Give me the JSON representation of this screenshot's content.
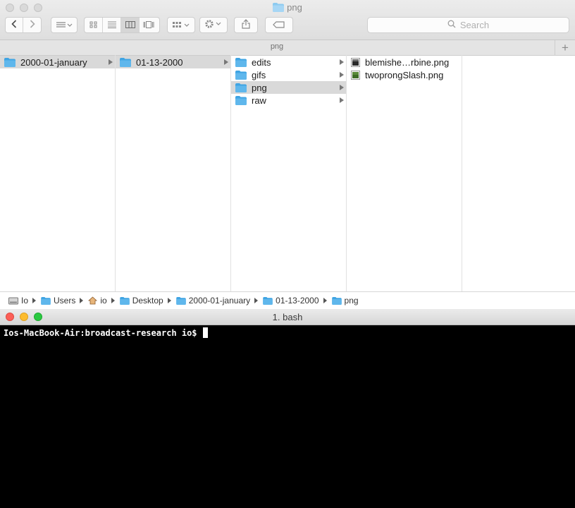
{
  "finder": {
    "window_title": "png",
    "search_placeholder": "Search",
    "tab_title": "png",
    "columns": [
      {
        "items": [
          {
            "label": "2000-01-january",
            "selected": true,
            "has_children": true
          }
        ]
      },
      {
        "items": [
          {
            "label": "01-13-2000",
            "selected": true,
            "has_children": true
          }
        ]
      },
      {
        "items": [
          {
            "label": "edits",
            "selected": false,
            "has_children": true
          },
          {
            "label": "gifs",
            "selected": false,
            "has_children": true
          },
          {
            "label": "png",
            "selected": true,
            "has_children": true
          },
          {
            "label": "raw",
            "selected": false,
            "has_children": true
          }
        ]
      },
      {
        "items": [
          {
            "label": "blemishe…rbine.png",
            "icon": "image-file-icon"
          },
          {
            "label": "twoprongSlash.png",
            "icon": "image-file-icon"
          }
        ]
      }
    ],
    "path": [
      {
        "label": "Io",
        "icon": "hard-drive-icon"
      },
      {
        "label": "Users",
        "icon": "folder-icon"
      },
      {
        "label": "io",
        "icon": "home-icon"
      },
      {
        "label": "Desktop",
        "icon": "folder-icon"
      },
      {
        "label": "2000-01-january",
        "icon": "folder-icon"
      },
      {
        "label": "01-13-2000",
        "icon": "folder-icon"
      },
      {
        "label": "png",
        "icon": "folder-icon"
      }
    ]
  },
  "terminal": {
    "title": "1. bash",
    "prompt": "Ios-MacBook-Air:broadcast-research io$ "
  },
  "colors": {
    "folder_blue": "#5fb7ec",
    "selection_gray": "#d9d9d9",
    "close_red": "#fc5f57",
    "minimize_yellow": "#fdbc2e",
    "zoom_green": "#2ac940"
  }
}
